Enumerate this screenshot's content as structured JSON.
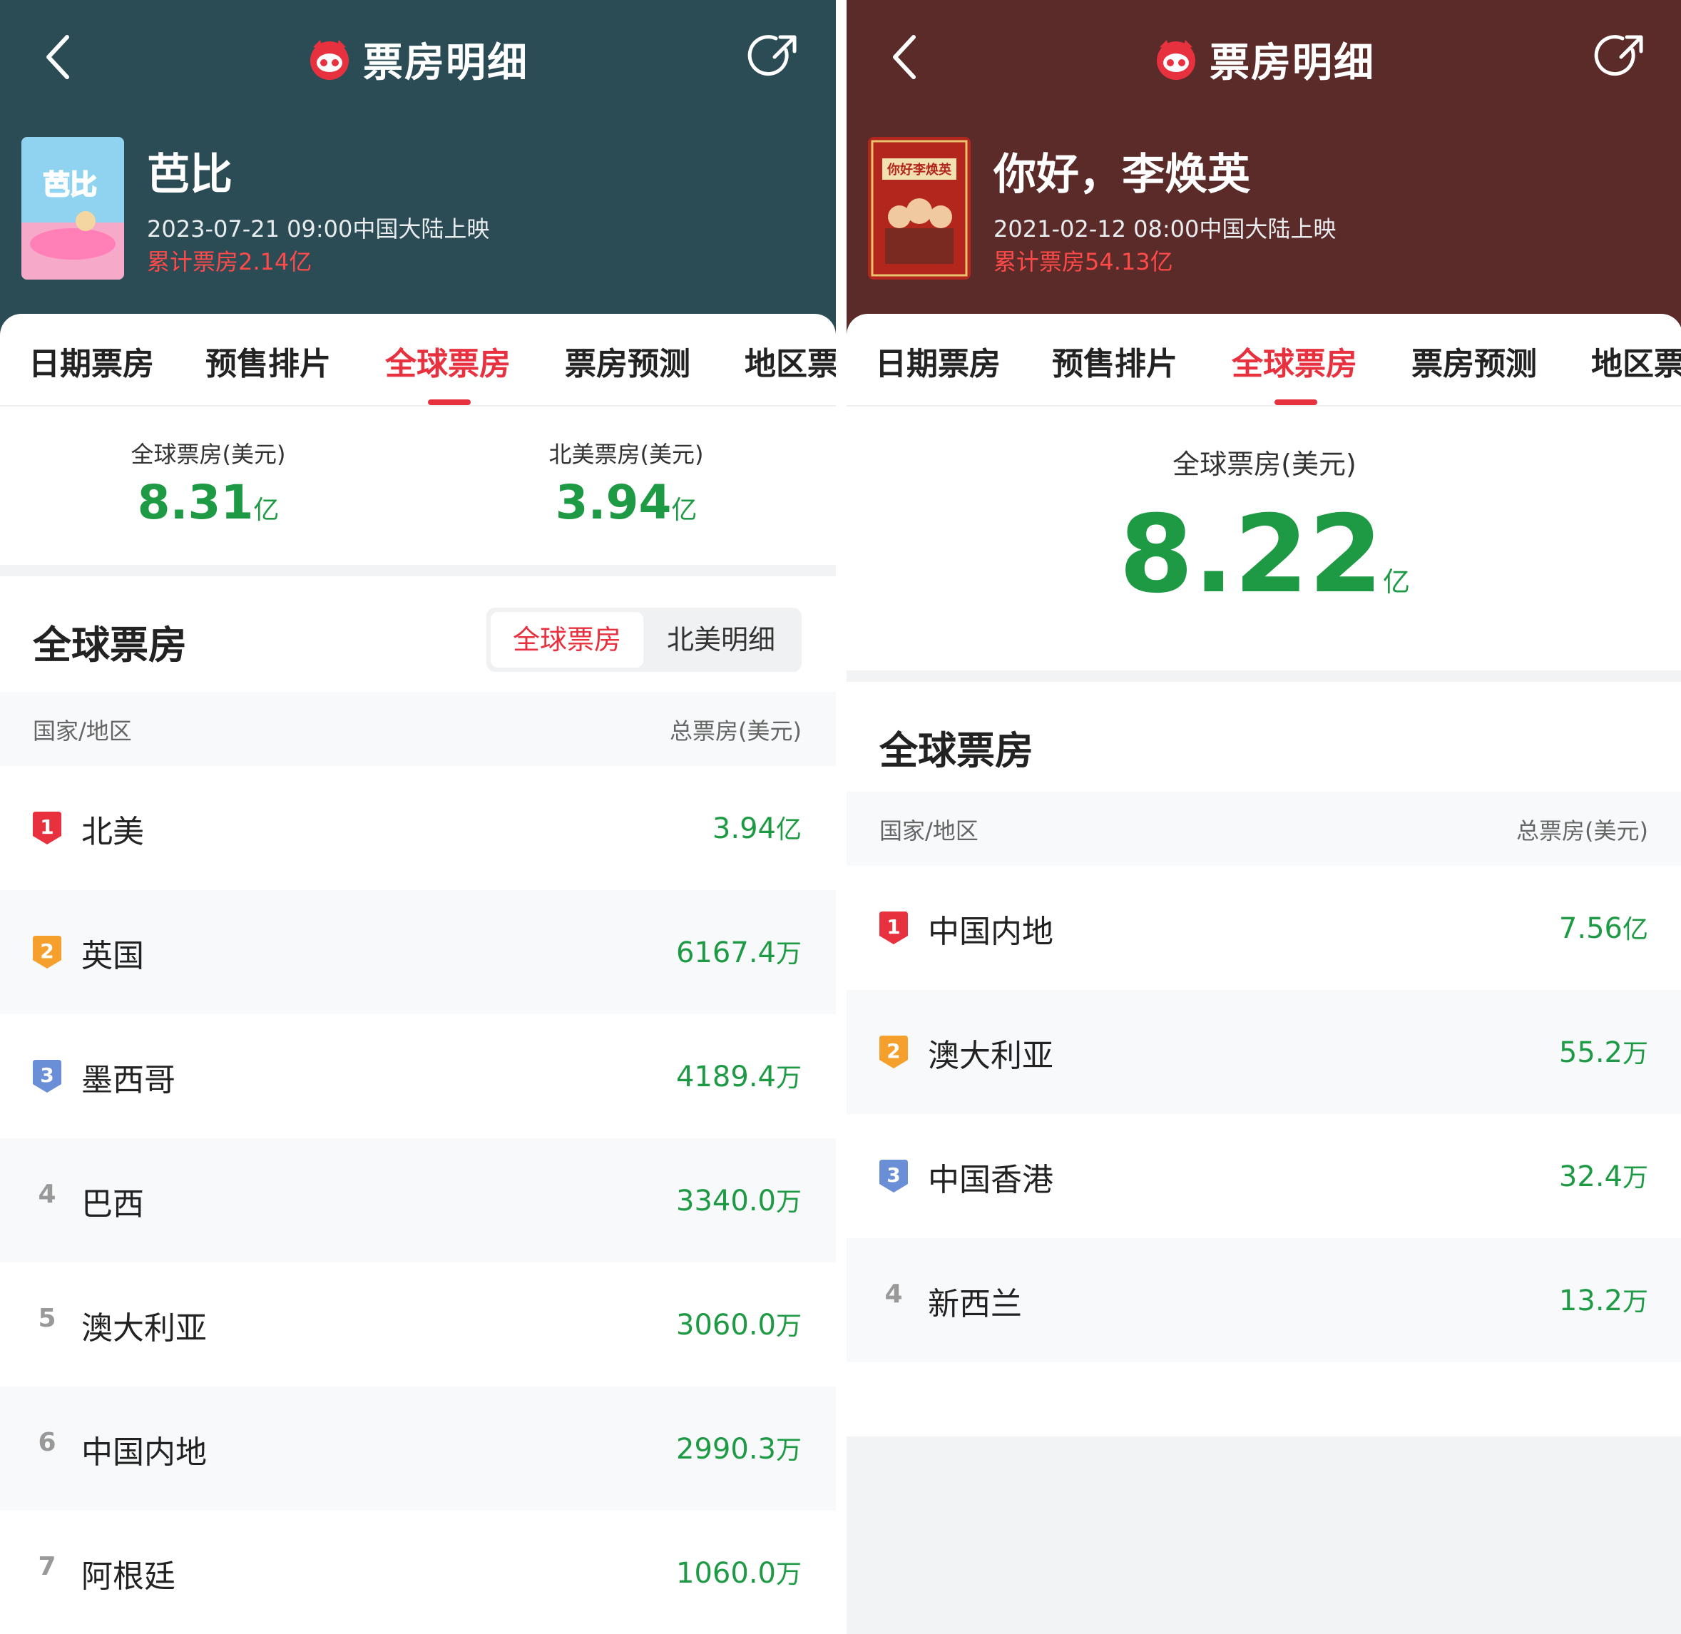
{
  "colors": {
    "left_header": "#2b4b55",
    "right_header": "#5a2b28",
    "accent_red": "#e8313f",
    "green": "#1e9a45"
  },
  "icons": {
    "back": "chevron-left-icon",
    "share": "share-icon",
    "logo": "maoyan-cat-icon"
  },
  "left": {
    "page_title": "票房明细",
    "movie_title": "芭比",
    "release": "2023-07-21 09:00中国大陆上映",
    "cumulative": "累计票房2.14亿",
    "poster_text": "芭比",
    "tabs": [
      {
        "label": "日期票房"
      },
      {
        "label": "预售排片"
      },
      {
        "label": "全球票房",
        "active": true
      },
      {
        "label": "票房预测"
      },
      {
        "label": "地区票"
      }
    ],
    "summary": [
      {
        "label": "全球票房(美元)",
        "value": "8.31",
        "unit": "亿"
      },
      {
        "label": "北美票房(美元)",
        "value": "3.94",
        "unit": "亿"
      }
    ],
    "section_title": "全球票房",
    "toggle": {
      "active": "全球票房",
      "inactive": "北美明细"
    },
    "table_header": {
      "region": "国家/地区",
      "gross": "总票房(美元)"
    },
    "rows": [
      {
        "rank": "1",
        "region": "北美",
        "value": "3.94",
        "unit": "亿"
      },
      {
        "rank": "2",
        "region": "英国",
        "value": "6167.4",
        "unit": "万"
      },
      {
        "rank": "3",
        "region": "墨西哥",
        "value": "4189.4",
        "unit": "万"
      },
      {
        "rank": "4",
        "region": "巴西",
        "value": "3340.0",
        "unit": "万"
      },
      {
        "rank": "5",
        "region": "澳大利亚",
        "value": "3060.0",
        "unit": "万"
      },
      {
        "rank": "6",
        "region": "中国内地",
        "value": "2990.3",
        "unit": "万"
      },
      {
        "rank": "7",
        "region": "阿根廷",
        "value": "1060.0",
        "unit": "万"
      }
    ]
  },
  "right": {
    "page_title": "票房明细",
    "movie_title": "你好，李焕英",
    "release": "2021-02-12 08:00中国大陆上映",
    "cumulative": "累计票房54.13亿",
    "poster_text": "你好李焕英",
    "tabs": [
      {
        "label": "日期票房"
      },
      {
        "label": "预售排片"
      },
      {
        "label": "全球票房",
        "active": true
      },
      {
        "label": "票房预测"
      },
      {
        "label": "地区票"
      }
    ],
    "summary": [
      {
        "label": "全球票房(美元)",
        "value": "8.22",
        "unit": "亿"
      }
    ],
    "section_title": "全球票房",
    "table_header": {
      "region": "国家/地区",
      "gross": "总票房(美元)"
    },
    "rows": [
      {
        "rank": "1",
        "region": "中国内地",
        "value": "7.56",
        "unit": "亿"
      },
      {
        "rank": "2",
        "region": "澳大利亚",
        "value": "55.2",
        "unit": "万"
      },
      {
        "rank": "3",
        "region": "中国香港",
        "value": "32.4",
        "unit": "万"
      },
      {
        "rank": "4",
        "region": "新西兰",
        "value": "13.2",
        "unit": "万"
      }
    ]
  }
}
